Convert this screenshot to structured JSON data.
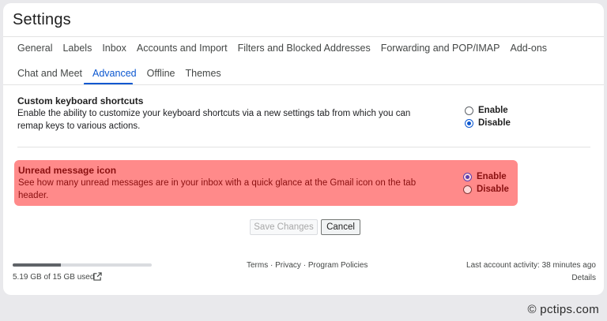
{
  "page_title": "Settings",
  "tabs_row1": [
    "General",
    "Labels",
    "Inbox",
    "Accounts and Import",
    "Filters and Blocked Addresses",
    "Forwarding and POP/IMAP",
    "Add-ons"
  ],
  "tabs_row2": [
    "Chat and Meet",
    "Advanced",
    "Offline",
    "Themes"
  ],
  "active_tab": "Advanced",
  "sections": [
    {
      "title": "Custom keyboard shortcuts",
      "description": "Enable the ability to customize your keyboard shortcuts via a new settings tab from which you can remap keys to various actions.",
      "options": [
        "Enable",
        "Disable"
      ],
      "selected": "Disable"
    },
    {
      "title": "Unread message icon",
      "description": "See how many unread messages are in your inbox with a quick glance at the Gmail icon on the tab header.",
      "options": [
        "Enable",
        "Disable"
      ],
      "selected": "Enable"
    }
  ],
  "buttons": {
    "save": "Save Changes",
    "cancel": "Cancel"
  },
  "footer": {
    "storage_text": "5.19 GB of 15 GB used",
    "storage_fraction": 0.346,
    "terms": "Terms",
    "privacy": "Privacy",
    "program_policies": "Program Policies",
    "separator": "·",
    "last_activity": "Last account activity: 38 minutes ago",
    "details": "Details"
  },
  "watermark": "© pctips.com",
  "colors": {
    "accent": "#0b57d0",
    "highlight": "#ff8a8a"
  }
}
